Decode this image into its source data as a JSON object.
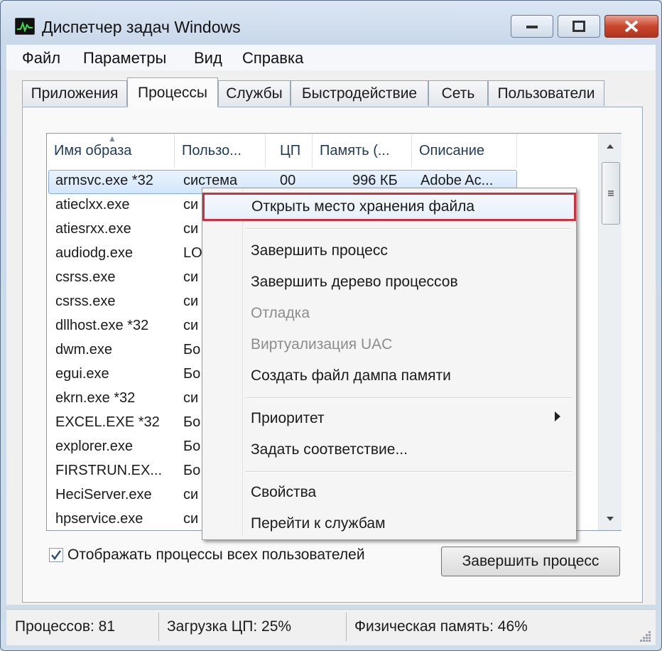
{
  "window": {
    "title": "Диспетчер задач Windows"
  },
  "menubar": [
    "Файл",
    "Параметры",
    "Вид",
    "Справка"
  ],
  "tabs": [
    "Приложения",
    "Процессы",
    "Службы",
    "Быстродействие",
    "Сеть",
    "Пользователи"
  ],
  "active_tab": "Процессы",
  "columns": [
    "Имя образа",
    "Пользо...",
    "ЦП",
    "Память (...",
    "Описание"
  ],
  "processes": [
    {
      "name": "armsvc.exe *32",
      "user": "система",
      "cpu": "00",
      "memory": "996 КБ",
      "desc": "Adobe Ac..."
    },
    {
      "name": "atieclxx.exe",
      "user": "си"
    },
    {
      "name": "atiesrxx.exe",
      "user": "си"
    },
    {
      "name": "audiodg.exe",
      "user": "LO"
    },
    {
      "name": "csrss.exe",
      "user": "си"
    },
    {
      "name": "csrss.exe",
      "user": "си"
    },
    {
      "name": "dllhost.exe *32",
      "user": "си"
    },
    {
      "name": "dwm.exe",
      "user": "Бо"
    },
    {
      "name": "egui.exe",
      "user": "Бо"
    },
    {
      "name": "ekrn.exe *32",
      "user": "си"
    },
    {
      "name": "EXCEL.EXE *32",
      "user": "Бо"
    },
    {
      "name": "explorer.exe",
      "user": "Бо"
    },
    {
      "name": "FIRSTRUN.EX...",
      "user": "Бо"
    },
    {
      "name": "HeciServer.exe",
      "user": "си"
    },
    {
      "name": "hpservice.exe",
      "user": "си"
    }
  ],
  "show_all_users": {
    "label": "Отображать процессы всех пользователей",
    "checked": true
  },
  "end_process_button": "Завершить процесс",
  "status": {
    "processes": "Процессов: 81",
    "cpu": "Загрузка ЦП: 25%",
    "memory": "Физическая память: 46%"
  },
  "context_menu": {
    "items": [
      {
        "label": "Открыть место хранения файла",
        "highlighted": true
      },
      {
        "label": "Завершить процесс"
      },
      {
        "label": "Завершить дерево процессов"
      },
      {
        "label": "Отладка",
        "disabled": true
      },
      {
        "label": "Виртуализация UAC",
        "disabled": true
      },
      {
        "label": "Создать файл дампа памяти"
      },
      {
        "label": "Приоритет",
        "submenu": true
      },
      {
        "label": "Задать соответствие..."
      },
      {
        "label": "Свойства"
      },
      {
        "label": "Перейти к службам"
      }
    ]
  },
  "colors": {
    "highlight_border": "#c9323e",
    "selection": "#d3e6fb",
    "close_button": "#c8472e"
  }
}
